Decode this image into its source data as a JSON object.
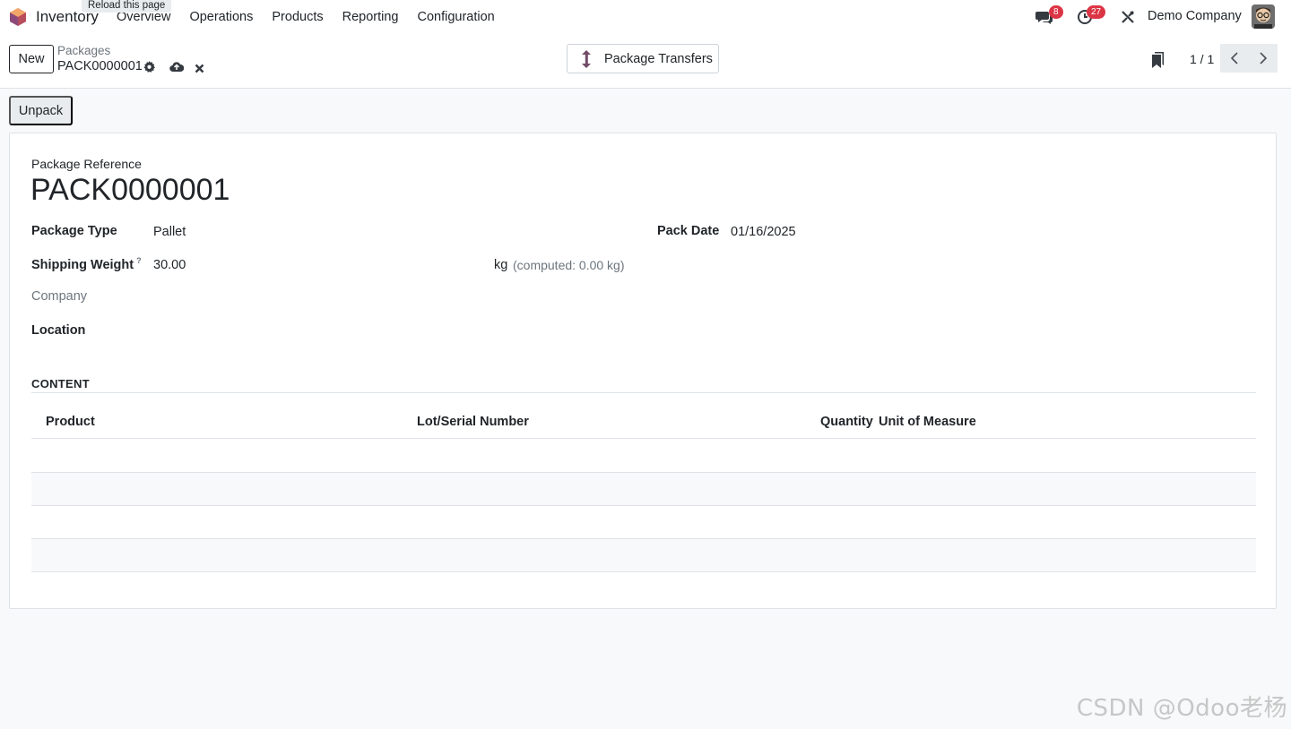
{
  "navbar": {
    "app_name": "Inventory",
    "tooltip": "Reload this page",
    "menu": [
      "Overview",
      "Operations",
      "Products",
      "Reporting",
      "Configuration"
    ],
    "messages_count": "8",
    "activities_count": "27",
    "company": "Demo Company"
  },
  "control_panel": {
    "new_label": "New",
    "breadcrumb_parent": "Packages",
    "breadcrumb_current": "PACK0000001",
    "smart_button_label": "Package Transfers",
    "pager_value": "1 / 1"
  },
  "actions": {
    "unpack_label": "Unpack"
  },
  "form": {
    "package_reference_label": "Package Reference",
    "package_reference": "PACK0000001",
    "package_type_label": "Package Type",
    "package_type": "Pallet",
    "pack_date_label": "Pack Date",
    "pack_date": "01/16/2025",
    "shipping_weight_label": "Shipping Weight",
    "shipping_weight_help": "?",
    "shipping_weight": "30.00",
    "weight_unit": "kg",
    "weight_computed": "(computed: 0.00 kg)",
    "company_label": "Company",
    "location_label": "Location"
  },
  "content": {
    "section_title": "CONTENT",
    "columns": [
      "Product",
      "Lot/Serial Number",
      "Quantity",
      "Unit of Measure"
    ],
    "rows": []
  },
  "watermark": "CSDN @Odoo老杨",
  "colors": {
    "accent": "#714b67",
    "badge": "#dc3545",
    "border": "#dee2e6",
    "muted_text": "#6c757d"
  }
}
